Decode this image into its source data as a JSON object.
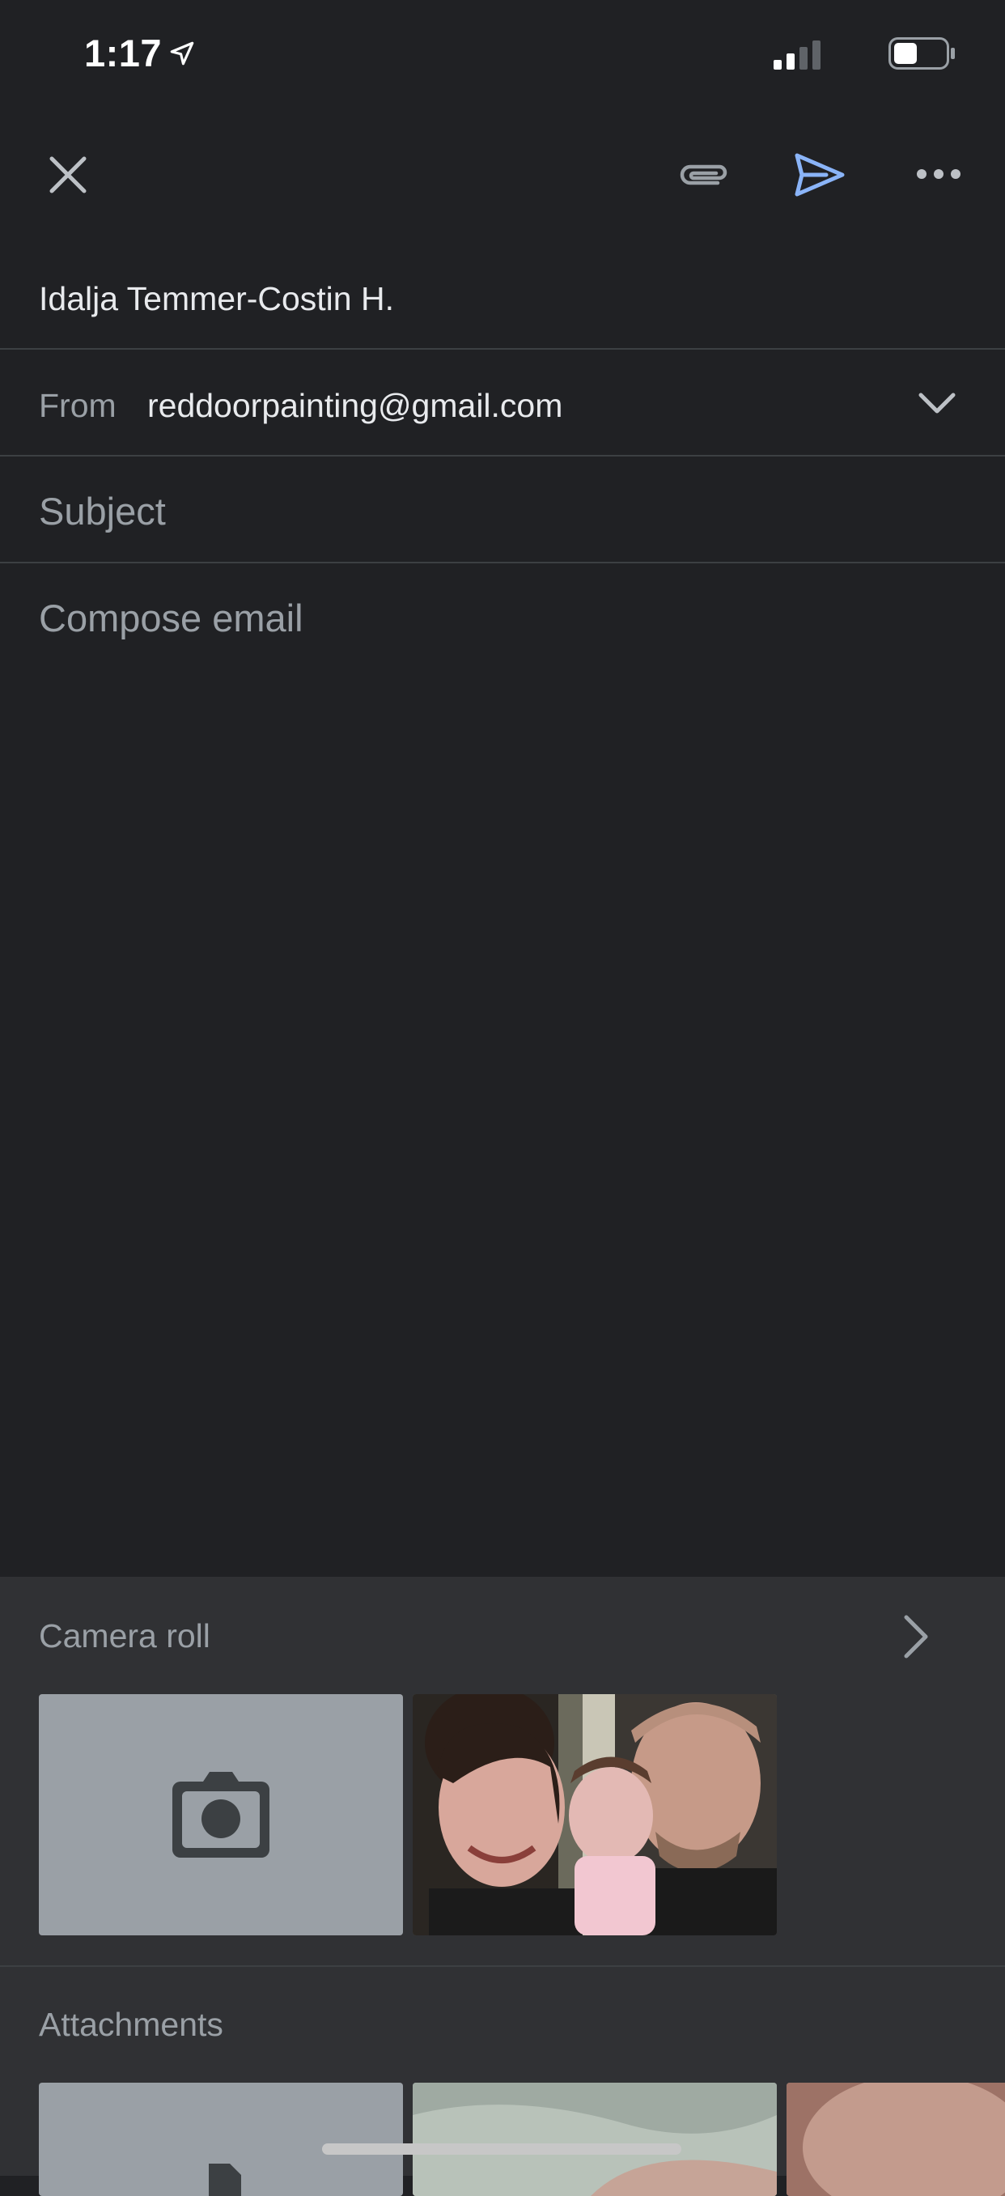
{
  "status_bar": {
    "time": "1:17",
    "location_icon": "location-arrow-icon",
    "signal_icon": "cellular-signal-icon",
    "battery_icon": "battery-icon",
    "battery_level": 0.45
  },
  "toolbar": {
    "close_icon": "close-icon",
    "attach_icon": "paperclip-icon",
    "send_icon": "send-icon",
    "send_color": "#8ab4f8",
    "more_icon": "more-horizontal-icon"
  },
  "compose": {
    "to": "Idalja Temmer-Costin H.",
    "from_label": "From",
    "from_value": "reddoorpainting@gmail.com",
    "subject_placeholder": "Subject",
    "body_placeholder": "Compose email"
  },
  "camera_roll": {
    "label": "Camera roll",
    "arrow_icon": "chevron-right-icon",
    "camera_icon": "camera-icon"
  },
  "attachments": {
    "label": "Attachments"
  }
}
